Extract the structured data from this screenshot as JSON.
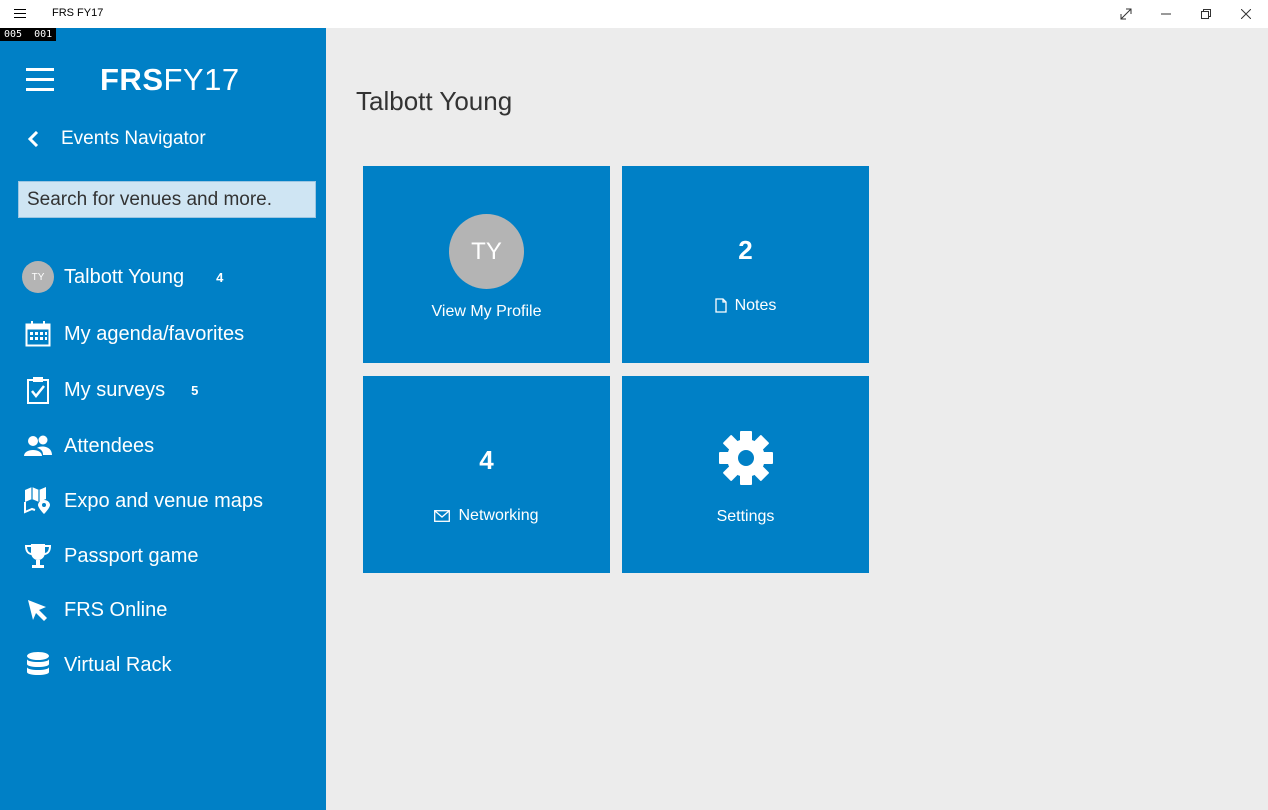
{
  "window": {
    "title": "FRS FY17",
    "frame_counter": [
      "005",
      "001"
    ]
  },
  "sidebar": {
    "logo_bold": "FRS",
    "logo_light": "FY17",
    "back_label": "Events Navigator",
    "search_placeholder": "Search for venues and more.",
    "items": [
      {
        "label": "Talbott Young",
        "badge": "4",
        "avatar": "TY",
        "icon": "avatar"
      },
      {
        "label": "My agenda/favorites",
        "badge": "",
        "icon": "calendar-icon"
      },
      {
        "label": "My surveys",
        "badge": "5",
        "icon": "clipboard-check-icon"
      },
      {
        "label": "Attendees",
        "badge": "",
        "icon": "people-icon"
      },
      {
        "label": "Expo and venue maps",
        "badge": "",
        "icon": "map-pin-icon"
      },
      {
        "label": "Passport game",
        "badge": "",
        "icon": "trophy-icon"
      },
      {
        "label": "FRS Online",
        "badge": "",
        "icon": "cursor-icon"
      },
      {
        "label": "Virtual Rack",
        "badge": "",
        "icon": "database-icon"
      }
    ]
  },
  "main": {
    "title": "Talbott Young",
    "tiles": {
      "profile": {
        "initials": "TY",
        "label": "View My Profile"
      },
      "notes": {
        "count": "2",
        "label": "Notes"
      },
      "networking": {
        "count": "4",
        "label": "Networking"
      },
      "settings": {
        "label": "Settings"
      }
    }
  },
  "colors": {
    "accent": "#0080c6",
    "background": "#ececec",
    "avatar": "#b4b4b4"
  }
}
